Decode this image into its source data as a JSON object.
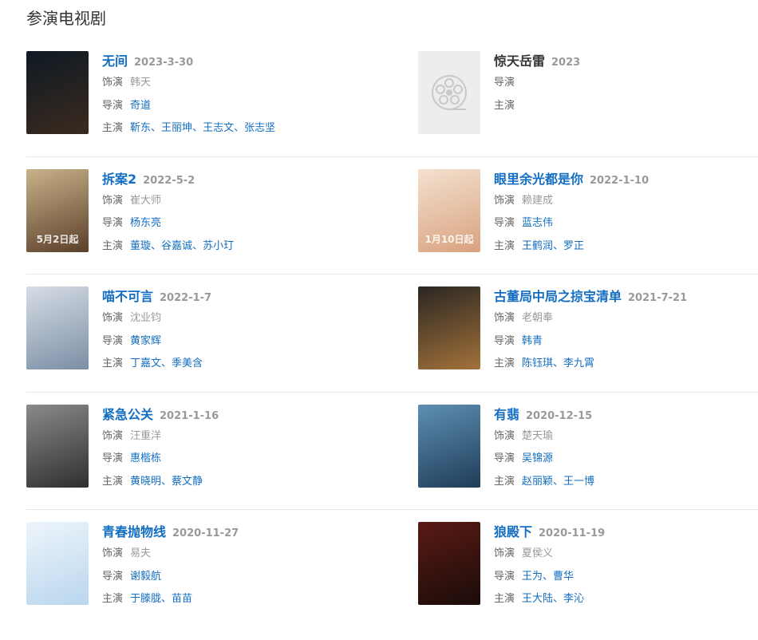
{
  "section": {
    "title": "参演电视剧"
  },
  "labels": {
    "role": "饰演",
    "director": "导演",
    "cast": "主演",
    "sep": "、"
  },
  "works": [
    {
      "title": "无间",
      "date": "2023-3-30",
      "role": "韩天",
      "director": [
        "奇道"
      ],
      "cast": [
        "靳东",
        "王丽坤",
        "王志文",
        "张志坚"
      ],
      "poster_colors": [
        "#0f1a24",
        "#3a2a1e"
      ]
    },
    {
      "title": "惊天岳雷",
      "date": "2023",
      "role": "",
      "director": [],
      "cast": [],
      "placeholder": true
    },
    {
      "title": "拆案2",
      "date": "2022-5-2",
      "role": "崔大师",
      "director": [
        "杨东亮"
      ],
      "cast": [
        "董璇",
        "谷嘉诚",
        "苏小玎"
      ],
      "poster_colors": [
        "#c9b28a",
        "#5b3f2a"
      ],
      "poster_text": "5月2日起"
    },
    {
      "title": "眼里余光都是你",
      "date": "2022-1-10",
      "role": "赖建成",
      "director": [
        "蓝志伟"
      ],
      "cast": [
        "王鹤润",
        "罗正"
      ],
      "poster_colors": [
        "#f3e1cf",
        "#d9a27f"
      ],
      "poster_text": "1月10日起"
    },
    {
      "title": "喵不可言",
      "date": "2022-1-7",
      "role": "沈业钧",
      "director": [
        "黄家辉"
      ],
      "cast": [
        "丁嘉文",
        "季美含"
      ],
      "poster_colors": [
        "#d6dde6",
        "#7b8ea5"
      ]
    },
    {
      "title": "古董局中局之掠宝清单",
      "date": "2021-7-21",
      "role": "老朝奉",
      "director": [
        "韩青"
      ],
      "cast": [
        "陈钰琪",
        "李九霄"
      ],
      "poster_colors": [
        "#2a2622",
        "#a3723a"
      ]
    },
    {
      "title": "紧急公关",
      "date": "2021-1-16",
      "role": "汪重洋",
      "director": [
        "惠楷栋"
      ],
      "cast": [
        "黄晓明",
        "蔡文静"
      ],
      "poster_colors": [
        "#8a8a8a",
        "#2f2f2f"
      ]
    },
    {
      "title": "有翡",
      "date": "2020-12-15",
      "role": "楚天瑜",
      "director": [
        "吴锦源"
      ],
      "cast": [
        "赵丽颖",
        "王一博"
      ],
      "poster_colors": [
        "#5e8fb3",
        "#1f3d58"
      ]
    },
    {
      "title": "青春抛物线",
      "date": "2020-11-27",
      "role": "易夫",
      "director": [
        "谢毅航"
      ],
      "cast": [
        "于滕胧",
        "苗苗"
      ],
      "poster_colors": [
        "#eef5fb",
        "#b9d6ee"
      ]
    },
    {
      "title": "狼殿下",
      "date": "2020-11-19",
      "role": "夏侯义",
      "director": [
        "王为",
        "曹华"
      ],
      "cast": [
        "王大陆",
        "李沁"
      ],
      "poster_colors": [
        "#5a1a14",
        "#1a0c0a"
      ]
    }
  ]
}
